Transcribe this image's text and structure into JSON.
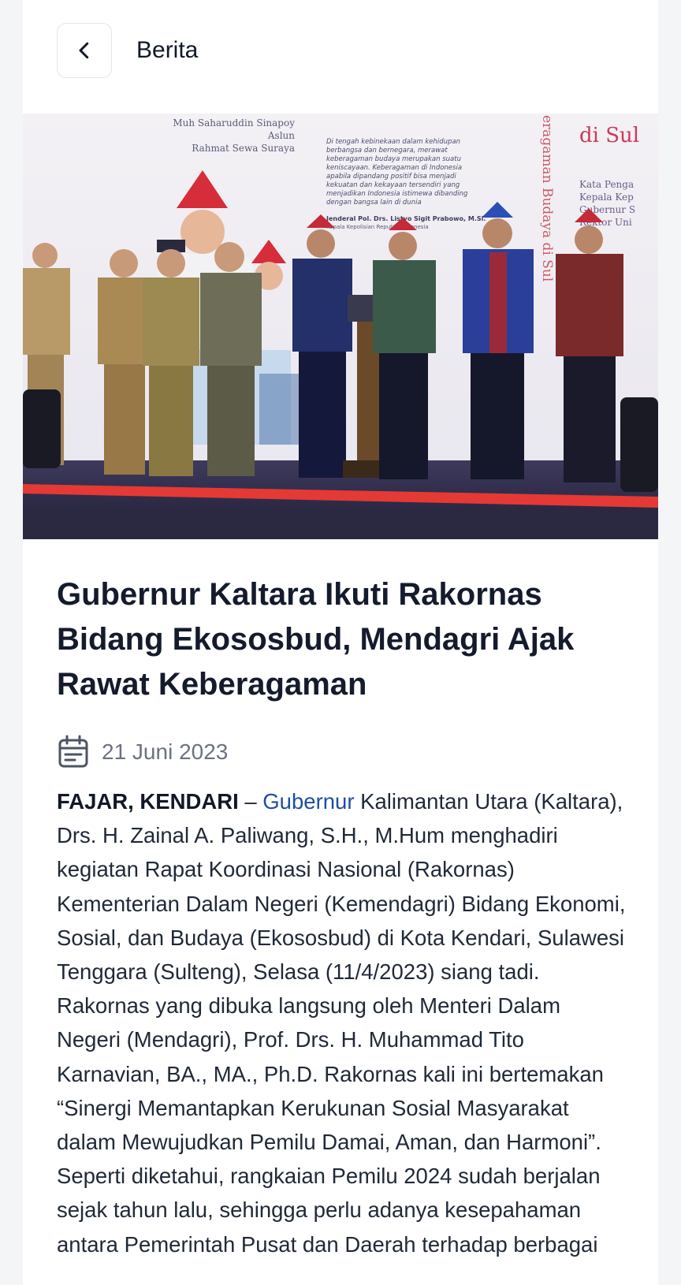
{
  "header": {
    "title": "Berita",
    "back_icon": "chevron-left-icon"
  },
  "hero": {
    "banner_names": [
      "Muh Saharuddin Sinapoy",
      "Aslun",
      "Rahmat Sewa Suraya"
    ],
    "banner_heading_fragment": "di Sul",
    "banner_vertical_text": "eragaman Budaya di Sul",
    "banner_small_text": "Di tengah kebinekaan dalam kehidupan berbangsa dan bernegara, merawat keberagaman budaya merupakan suatu keniscayaan. Keberagaman di Indonesia apabila dipandang positif bisa menjadi kekuatan dan kekayaan tersendiri yang menjadikan Indonesia istimewa dibanding dengan bangsa lain di dunia",
    "banner_quote_author": "Jenderal Pol. Drs. Listyo Sigit Prabowo, M.Si.",
    "banner_quote_role": "Kepala Kepolisian Republik Indonesia",
    "banner_side_text": [
      "Kata Penga",
      "Kepala Kep",
      "Gubernur S",
      "Rektor Uni"
    ]
  },
  "article": {
    "title": "Gubernur Kaltara Ikuti Rakornas Bidang Ekososbud, Mendagri Ajak Rawat Keberagaman",
    "date_icon": "calendar-icon",
    "date": "21 Juni 2023",
    "lead_bold": "FAJAR, KENDARI",
    "lead_dash": " – ",
    "lead_link": "Gubernur",
    "para1_rest": " Kalimantan Utara (Kaltara), Drs. H. Zainal A. Paliwang, S.H., M.Hum menghadiri kegiatan Rapat Koordinasi Nasional (Rakornas) Kementerian Dalam Negeri (Kemendagri) Bidang Ekonomi, Sosial, dan Budaya (Ekososbud) di Kota Kendari, Sulawesi Tenggara (Sulteng), Selasa (11/4/2023) siang tadi.",
    "para2": "Rakornas yang dibuka langsung oleh Menteri Dalam Negeri (Mendagri), Prof. Drs. H. Muhammad Tito Karnavian, BA., MA., Ph.D. Rakornas kali ini bertemakan “Sinergi Memantapkan Kerukunan Sosial Masyarakat dalam Mewujudkan Pemilu Damai, Aman, dan Harmoni”. Seperti diketahui, rangkaian Pemilu 2024 sudah berjalan sejak tahun lalu, sehingga perlu adanya kesepahaman antara Pemerintah Pusat dan Daerah terhadap berbagai"
  },
  "colors": {
    "link": "#1d4fa3",
    "title": "#141b2d",
    "muted": "#6b7280",
    "stage_red": "#e53935"
  }
}
